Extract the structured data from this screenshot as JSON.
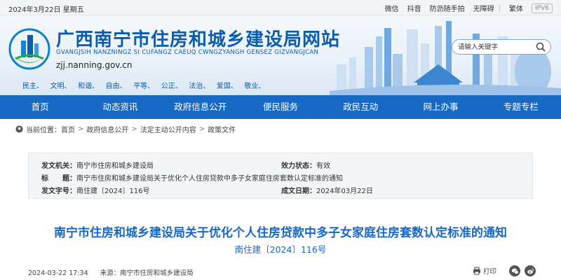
{
  "topbar": {
    "date": "2024年3月22日 星期五",
    "links": [
      "微信",
      "抖音",
      "防沥随手拍",
      "无障碍",
      "繁体"
    ],
    "ipv6": "IPV6"
  },
  "header": {
    "title": "广西南宁市住房和城乡建设局网站",
    "pinyin": "GVANGJSIH NANZNINGZ SI CUFANGZ CAEUQ CWNGZYANGH GENSEZ GIZVANGJCAN",
    "domain": "zjj.nanning.gov.cn",
    "values": [
      "民主、",
      "文明、",
      "和谐、",
      "自由、",
      "平等、",
      "公正、",
      "法治、",
      "爱国、",
      "敬业、"
    ]
  },
  "search": {
    "placeholder": "请输入关键字"
  },
  "nav": [
    "首页",
    "动态资讯",
    "政府信息公开",
    "便民服务",
    "政民互动",
    "网上办事",
    "专题专栏"
  ],
  "breadcrumb": {
    "label": "当前位置：",
    "items": [
      "首页",
      "政府信息公开",
      "法定主动公开内容",
      "政策文件"
    ]
  },
  "meta": {
    "issuer_label": "发文机关：",
    "issuer": "南宁市住房和城乡建设局",
    "status_label": "效力状态：",
    "status": "有效",
    "title_label": "标　　题：",
    "title": "南宁市住房和城乡建设局关于优化个人住房贷款中多子女家庭住房套数认定标准的通知",
    "docno_label": "发文字号：",
    "docno": "南住建〔2024〕116号",
    "date_label": "成文日期：",
    "date": "2024年03月22日"
  },
  "article": {
    "title": "南宁市住房和城乡建设局关于优化个人住房贷款中多子女家庭住房套数认定标准的通知",
    "doc_no": "南住建〔2024〕116号",
    "published": "2024-03-22 17:34",
    "source_label": "来源：",
    "source": "南宁市住房和城乡建设局",
    "print_label": "打印"
  },
  "colors": {
    "brand": "#1769c4",
    "title": "#0b5cad",
    "panel": "#f3f6f9"
  }
}
